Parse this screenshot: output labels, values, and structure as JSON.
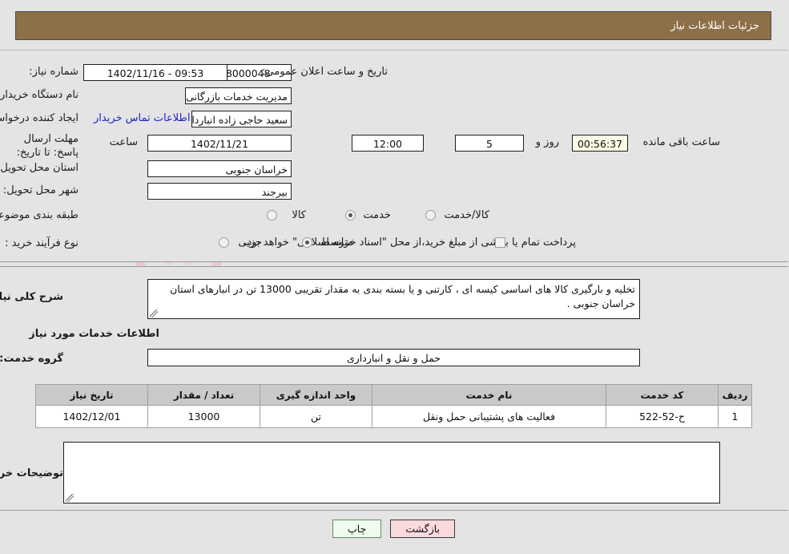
{
  "header": {
    "title": "جزئیات اطلاعات نیاز"
  },
  "fields": {
    "need_number_label": "شماره نیاز:",
    "need_number_value": "1102090628000048",
    "announce_label": "تاریخ و ساعت اعلان عمومی:",
    "announce_value": "09:53 - 1402/11/16",
    "buyer_org_label": "نام دستگاه خریدار:",
    "buyer_org_value": "مدیریت خدمات بازرگانی دولتی استان خراسان جنوبی",
    "creator_label": "ایجاد کننده درخواست:",
    "creator_value": "سعید حاجی زاده انباردار مدیریت خدمات بازرگانی دولتی استان خراسان جنوبی",
    "contact_link": "اطلاعات تماس خریدار",
    "deadline_label": "مهلت ارسال پاسخ: تا تاریخ:",
    "deadline_date": "1402/11/21",
    "hour_label": "ساعت",
    "deadline_time": "12:00",
    "days_left": "5",
    "days_word": "روز و",
    "time_left": "00:56:37",
    "time_left_suffix": "ساعت باقی مانده",
    "province_label": "استان محل تحویل:",
    "province_value": "خراسان جنوبی",
    "city_label": "شهر محل تحویل:",
    "city_value": "بیرجند",
    "category_label": "طبقه بندی موضوعی:",
    "category_options": [
      "کالا",
      "خدمت",
      "کالا/خدمت"
    ],
    "category_selected": "خدمت",
    "process_label": "نوع فرآیند خرید :",
    "process_options": [
      "جزیی",
      "متوسط"
    ],
    "process_selected": "متوسط",
    "treasury_note": "پرداخت تمام یا بخشی از مبلغ خرید،از محل \"اسناد خزانه اسلامی\" خواهد بود.",
    "summary_label": "شرح کلی نیاز:",
    "summary_value": "تخلیه و بارگیری کالا های اساسی کیسه ای ، کارتنی و یا بسته بندی به مقدار تقریبی 13000 تن در انبارهای استان خراسان جنوبی .",
    "services_section_title": "اطلاعات خدمات مورد نیاز",
    "service_group_label": "گروه خدمت:",
    "service_group_value": "حمل و نقل و انبارداری",
    "buyer_notes_label": "توضیحات خریدار:",
    "buyer_notes_value": ""
  },
  "table": {
    "columns": [
      "ردیف",
      "کد خدمت",
      "نام خدمت",
      "واحد اندازه گیری",
      "تعداد / مقدار",
      "تاریخ نیاز"
    ],
    "rows": [
      {
        "row": "1",
        "code": "ح-52-522",
        "name": "فعالیت های پشتیبانی حمل ونقل",
        "unit": "تن",
        "qty": "13000",
        "date": "1402/12/01"
      }
    ]
  },
  "buttons": {
    "print": "چاپ",
    "back": "بازگشت"
  },
  "watermark": {
    "text": "AriaTender.net"
  },
  "colors": {
    "header_bg": "#8d6f48",
    "page_bg": "#e4e4e4",
    "link": "#2222cc",
    "table_header_bg": "#c9c9c9",
    "highlight_bg": "#fbfae4",
    "btn_back_bg": "#fadadd",
    "btn_print_bg": "#effbef"
  }
}
